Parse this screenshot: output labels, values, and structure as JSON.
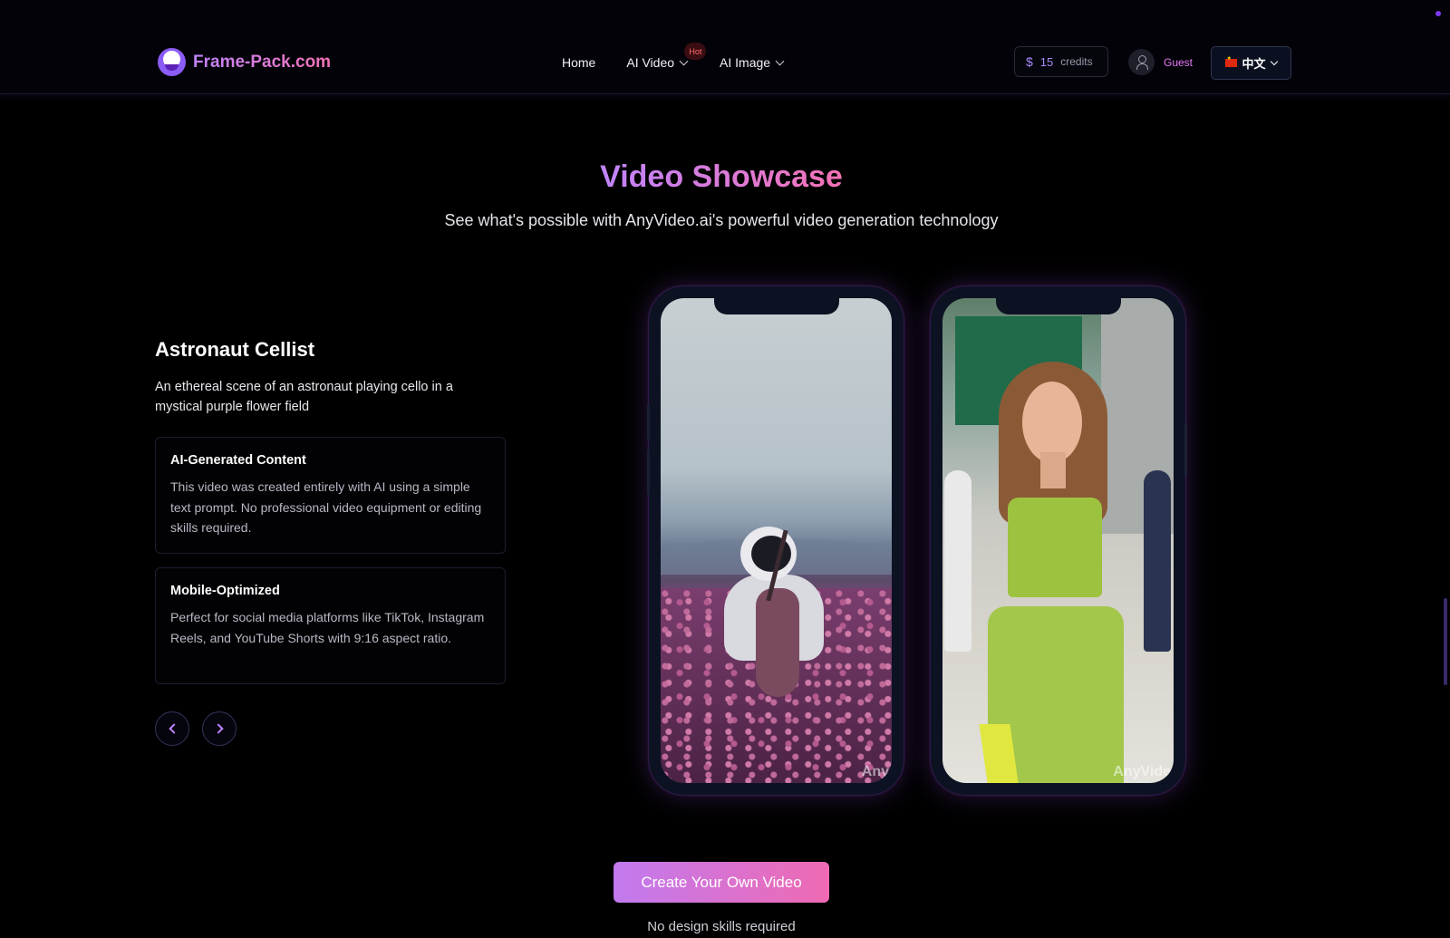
{
  "brand": {
    "name": "Frame-Pack.com",
    "logo_icon": "frog-logo-icon"
  },
  "nav": {
    "home": "Home",
    "ai_video": "AI Video",
    "ai_video_badge": "Hot",
    "ai_image": "AI Image"
  },
  "account": {
    "credits_value": "15",
    "credits_label": "credits",
    "user_label": "Guest",
    "language": "中文"
  },
  "showcase": {
    "title": "Video Showcase",
    "subtitle": "See what's possible with AnyVideo.ai's powerful video generation technology",
    "current": {
      "title": "Astronaut Cellist",
      "description": "An ethereal scene of an astronaut playing cello in a mystical purple flower field"
    },
    "features": [
      {
        "title": "AI-Generated Content",
        "text": "This video was created entirely with AI using a simple text prompt. No professional video equipment or editing skills required."
      },
      {
        "title": "Mobile-Optimized",
        "text": "Perfect for social media platforms like TikTok, Instagram Reels, and YouTube Shorts with 9:16 aspect ratio."
      }
    ],
    "watermarks": [
      "Any",
      "AnyVide"
    ]
  },
  "cta": {
    "button": "Create Your Own Video",
    "note": "No design skills required"
  },
  "colors": {
    "accent_purple": "#c084fc",
    "accent_pink": "#f472b6",
    "background": "#000000"
  }
}
